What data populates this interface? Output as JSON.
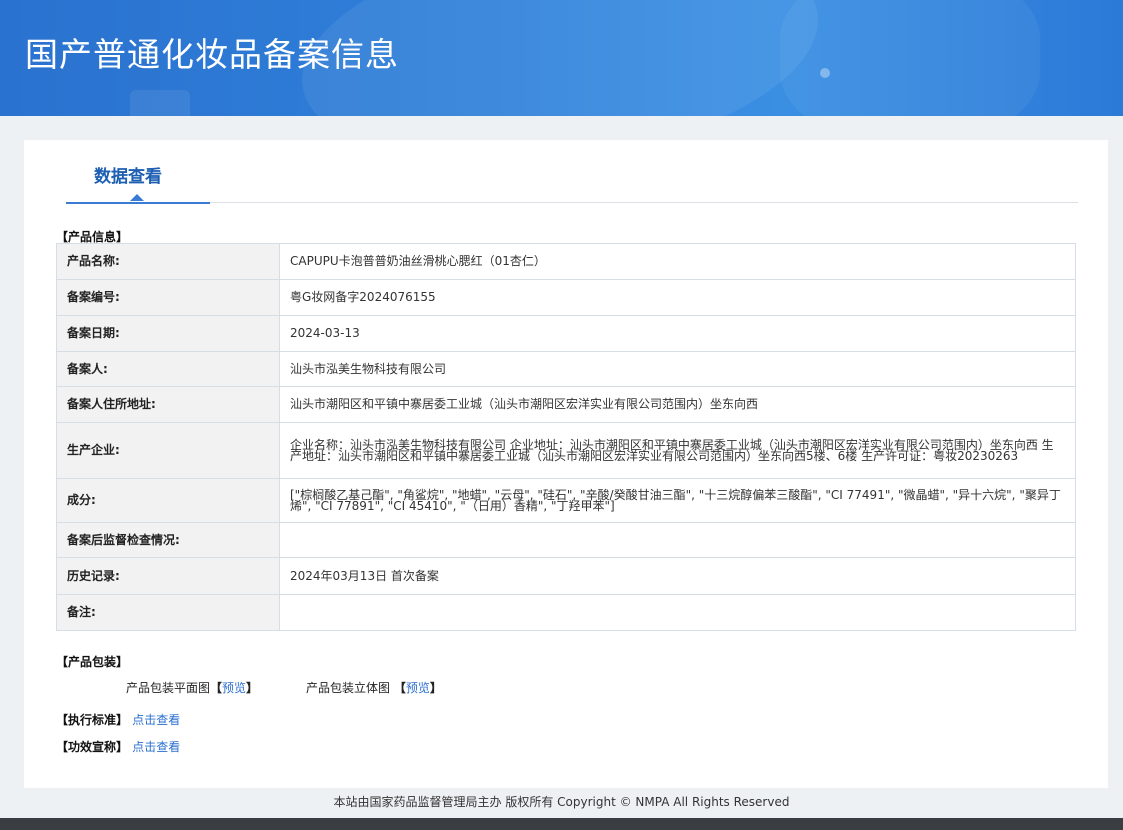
{
  "header": {
    "title": "国产普通化妆品备案信息"
  },
  "tabs": [
    {
      "label": "数据查看"
    }
  ],
  "product_info": {
    "section_title": "【产品信息】",
    "rows": [
      {
        "key": "产品名称:",
        "value": "CAPUPU卡泡普普奶油丝滑桃心腮红（01杏仁）"
      },
      {
        "key": "备案编号:",
        "value": "粤G妆网备字2024076155"
      },
      {
        "key": "备案日期:",
        "value": "2024-03-13"
      },
      {
        "key": "备案人:",
        "value": "汕头市泓美生物科技有限公司"
      },
      {
        "key": "备案人住所地址:",
        "value": "汕头市潮阳区和平镇中寨居委工业城（汕头市潮阳区宏洋实业有限公司范围内）坐东向西"
      },
      {
        "key": "生产企业:",
        "value": "企业名称：汕头市泓美生物科技有限公司 企业地址：汕头市潮阳区和平镇中寨居委工业城（汕头市潮阳区宏洋实业有限公司范围内）坐东向西 生产地址：汕头市潮阳区和平镇中寨居委工业城（汕头市潮阳区宏洋实业有限公司范围内）坐东向西5楼、6楼 生产许可证：粤妆20230263"
      },
      {
        "key": "成分:",
        "value": "[\"棕榈酸乙基己酯\", \"角鲨烷\", \"地蜡\", \"云母\", \"硅石\", \"辛酸/癸酸甘油三酯\", \"十三烷醇偏苯三酸酯\", \"CI 77491\", \"微晶蜡\", \"异十六烷\", \"聚异丁烯\", \"CI 77891\", \"CI 45410\", \"（日用）香精\", \"丁羟甲苯\"]"
      },
      {
        "key": "备案后监督检查情况:",
        "value": ""
      },
      {
        "key": "历史记录:",
        "value": "2024年03月13日 首次备案"
      },
      {
        "key": "备注:",
        "value": ""
      }
    ]
  },
  "packaging": {
    "section_title": "【产品包装】",
    "flat_label": "产品包装平面图",
    "solid_label": "产品包装立体图",
    "preview_link": "预览",
    "bracket_open": "【",
    "bracket_close": "】"
  },
  "standard": {
    "label": "【执行标准】",
    "link": "点击查看"
  },
  "efficacy": {
    "label": "【功效宣称】",
    "link": "点击查看"
  },
  "footer": {
    "text": "本站由国家药品监督管理局主办 版权所有 Copyright © NMPA All Rights Reserved"
  },
  "colors": {
    "banner": "#2f7fd9",
    "accent": "#3a7bd5",
    "link": "#2b6fd0",
    "footer_bar": "#3a3d42"
  }
}
